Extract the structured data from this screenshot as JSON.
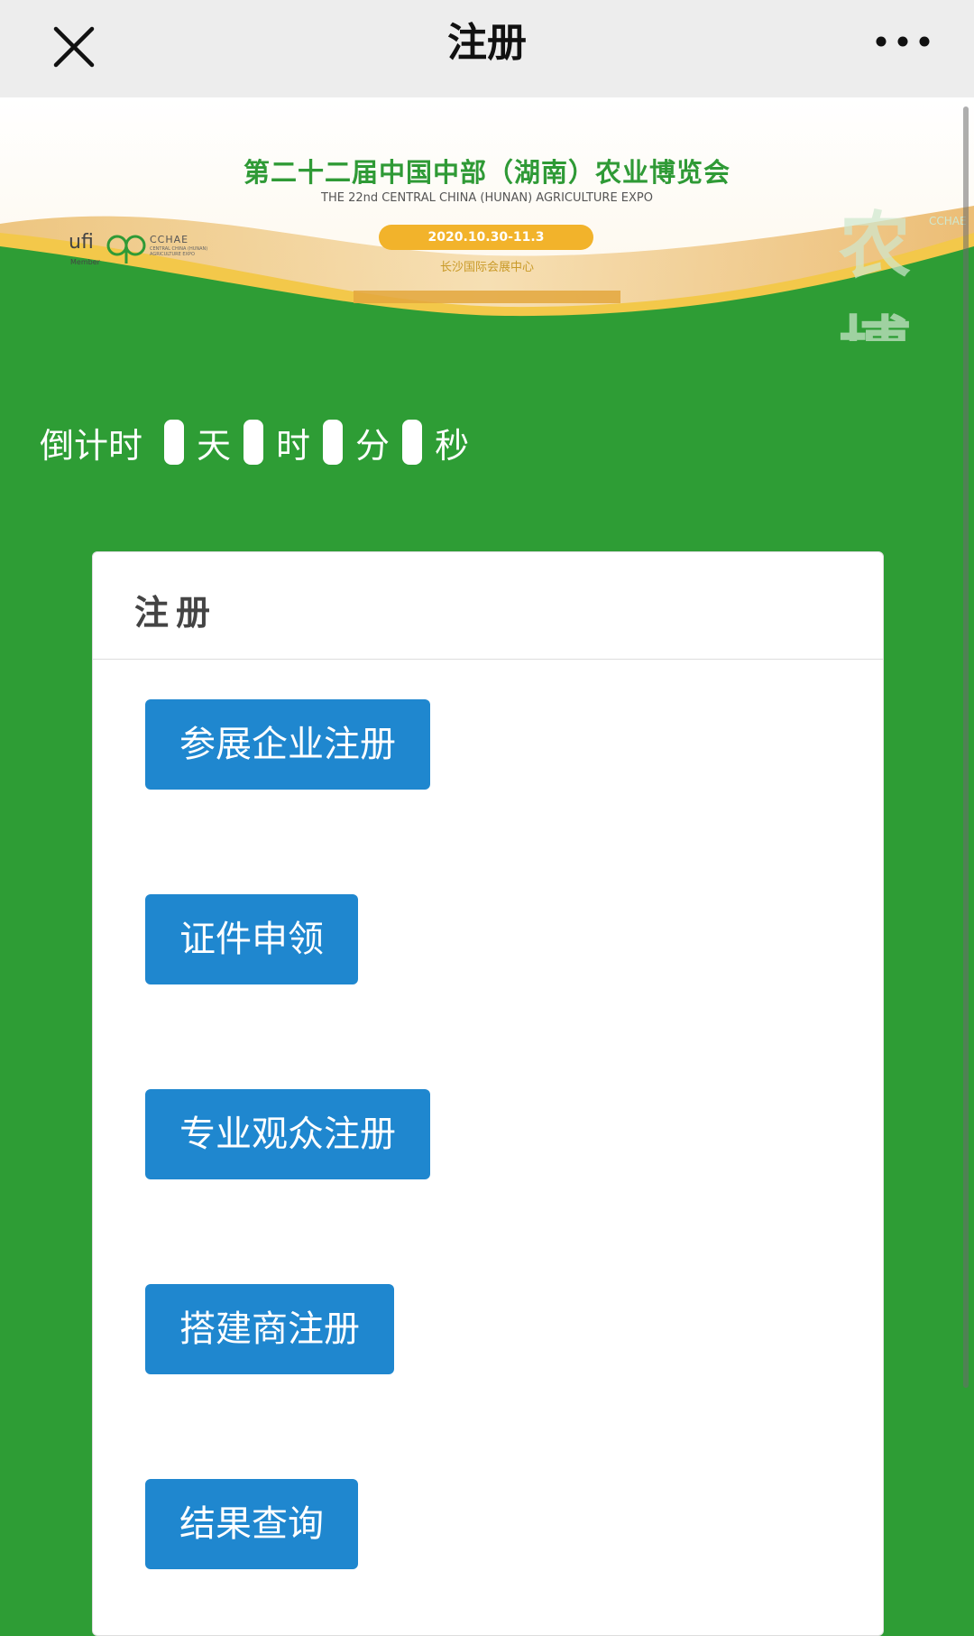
{
  "navbar": {
    "title": "注册",
    "close_icon": "close-icon",
    "more_icon": "more-dots-icon"
  },
  "banner": {
    "ufi_logo": "ufi",
    "ufi_member": "Member",
    "cchae_logo": "CCHAE",
    "cchae_sub": "CENTRAL CHINA (HUNAN) AGRICULTURE EXPO",
    "title": "第二十二届中国中部（湖南）农业博览会",
    "subtitle": "THE 22nd CENTRAL CHINA (HUNAN) AGRICULTURE EXPO",
    "date": "2020.10.30-11.3",
    "venue": "长沙国际会展中心",
    "watermark": "农博",
    "watermark_small": "CCHAE"
  },
  "countdown": {
    "label": "倒计时",
    "units": [
      "天",
      "时",
      "分",
      "秒"
    ]
  },
  "card": {
    "title": "注册",
    "buttons": [
      "参展企业注册",
      "证件申领",
      "专业观众注册",
      "搭建商注册",
      "结果查询"
    ]
  },
  "colors": {
    "background_green": "#2e9d35",
    "button_blue": "#1f87cf",
    "date_pill": "#f2b32b"
  }
}
